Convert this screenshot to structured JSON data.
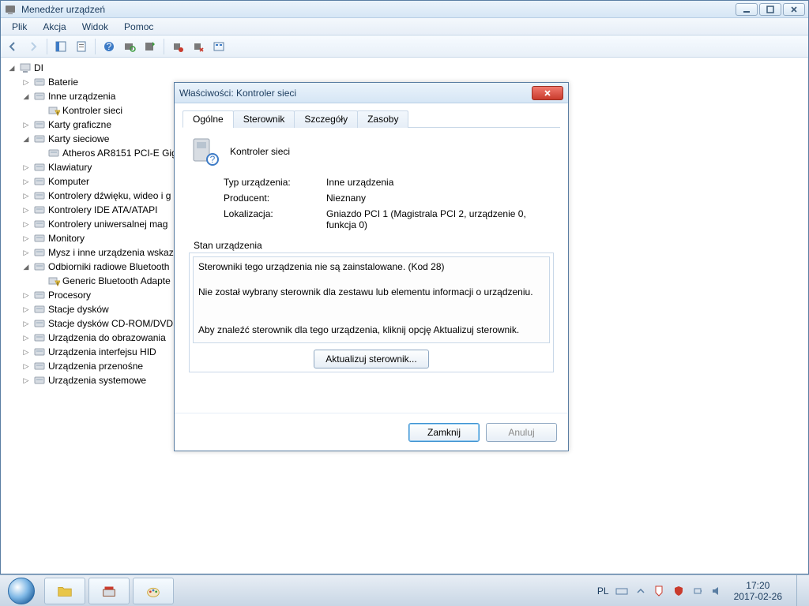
{
  "window": {
    "title": "Menedżer urządzeń",
    "menu": [
      "Plik",
      "Akcja",
      "Widok",
      "Pomoc"
    ]
  },
  "tree": {
    "root": "DI",
    "nodes": [
      {
        "label": "Baterie",
        "expanded": false
      },
      {
        "label": "Inne urządzenia",
        "expanded": true,
        "children": [
          {
            "label": "Kontroler sieci",
            "warn": true
          }
        ]
      },
      {
        "label": "Karty graficzne",
        "expanded": false
      },
      {
        "label": "Karty sieciowe",
        "expanded": true,
        "children": [
          {
            "label": "Atheros AR8151 PCI-E Gig"
          }
        ]
      },
      {
        "label": "Klawiatury",
        "expanded": false
      },
      {
        "label": "Komputer",
        "expanded": false
      },
      {
        "label": "Kontrolery dźwięku, wideo i g",
        "expanded": false
      },
      {
        "label": "Kontrolery IDE ATA/ATAPI",
        "expanded": false
      },
      {
        "label": "Kontrolery uniwersalnej mag",
        "expanded": false
      },
      {
        "label": "Monitory",
        "expanded": false
      },
      {
        "label": "Mysz i inne urządzenia wskaz",
        "expanded": false
      },
      {
        "label": "Odbiorniki radiowe Bluetooth",
        "expanded": true,
        "children": [
          {
            "label": "Generic Bluetooth Adapte",
            "warn": true
          }
        ]
      },
      {
        "label": "Procesory",
        "expanded": false
      },
      {
        "label": "Stacje dysków",
        "expanded": false
      },
      {
        "label": "Stacje dysków CD-ROM/DVD",
        "expanded": false
      },
      {
        "label": "Urządzenia do obrazowania",
        "expanded": false
      },
      {
        "label": "Urządzenia interfejsu HID",
        "expanded": false
      },
      {
        "label": "Urządzenia przenośne",
        "expanded": false
      },
      {
        "label": "Urządzenia systemowe",
        "expanded": false
      }
    ]
  },
  "dialog": {
    "title": "Właściwości: Kontroler sieci",
    "tabs": [
      "Ogólne",
      "Sterownik",
      "Szczegóły",
      "Zasoby"
    ],
    "active_tab": 0,
    "device_name": "Kontroler sieci",
    "labels": {
      "type": "Typ urządzenia:",
      "manufacturer": "Producent:",
      "location": "Lokalizacja:"
    },
    "values": {
      "type": "Inne urządzenia",
      "manufacturer": "Nieznany",
      "location": "Gniazdo PCI 1 (Magistrala PCI 2, urządzenie 0, funkcja 0)"
    },
    "status_group_label": "Stan urządzenia",
    "status_lines": [
      "Sterowniki tego urządzenia nie są zainstalowane. (Kod 28)",
      "",
      "Nie został wybrany sterownik dla zestawu lub elementu informacji o urządzeniu.",
      "",
      "",
      "Aby znaleźć sterownik dla tego urządzenia, kliknij opcję Aktualizuj sterownik."
    ],
    "update_button": "Aktualizuj sterownik...",
    "close_button": "Zamknij",
    "cancel_button": "Anuluj"
  },
  "taskbar": {
    "lang": "PL",
    "time": "17:20",
    "date": "2017-02-26"
  }
}
